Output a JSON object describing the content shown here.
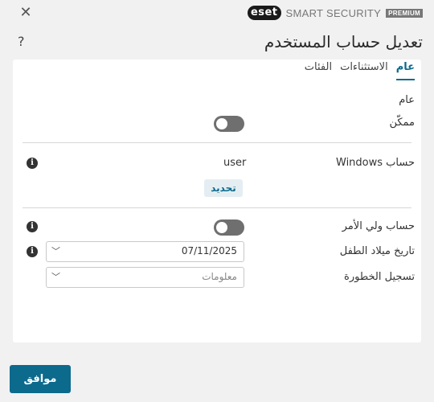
{
  "window": {
    "close_glyph": "✕",
    "logo_text": "eset",
    "product_name": "SMART SECURITY",
    "product_edition": "PREMIUM",
    "help_glyph": "?"
  },
  "page": {
    "title": "تعديل حساب المستخدم"
  },
  "tabs": [
    {
      "label": "عام",
      "active": true
    },
    {
      "label": "الاستثناءات",
      "active": false
    },
    {
      "label": "الفئات",
      "active": false
    }
  ],
  "general": {
    "section_label": "عام",
    "enabled_label": "ممكّن",
    "enabled_value": false
  },
  "windows_account": {
    "label": "حساب Windows",
    "value": "user",
    "change_button": "تحديد",
    "info_glyph": "i"
  },
  "parent_account": {
    "label": "حساب ولي الأمر",
    "value": false,
    "info_glyph": "i"
  },
  "child_birthdate": {
    "label": "تاريخ ميلاد الطفل",
    "value": "07/11/2025",
    "info_glyph": "i"
  },
  "risk_level": {
    "label": "تسجيل الخطورة",
    "value": "معلومات"
  },
  "footer": {
    "ok_button": "موافق"
  },
  "colors": {
    "accent": "#0c6a8d",
    "toggle_off": "#6f6f6f",
    "background": "#f1f1f2",
    "card": "#ffffff"
  }
}
